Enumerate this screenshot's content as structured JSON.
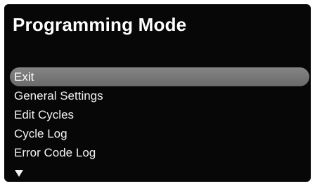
{
  "screen": {
    "title": "Programming Mode"
  },
  "menu": {
    "items": [
      {
        "label": "Exit",
        "selected": true
      },
      {
        "label": "General Settings",
        "selected": false
      },
      {
        "label": "Edit Cycles",
        "selected": false
      },
      {
        "label": "Cycle Log",
        "selected": false
      },
      {
        "label": "Error Code Log",
        "selected": false
      }
    ],
    "more_indicator_icon": "triangle-down-icon"
  },
  "colors": {
    "background": "#070707",
    "text": "#f2f2f2",
    "selection": "#7a7a7a"
  }
}
